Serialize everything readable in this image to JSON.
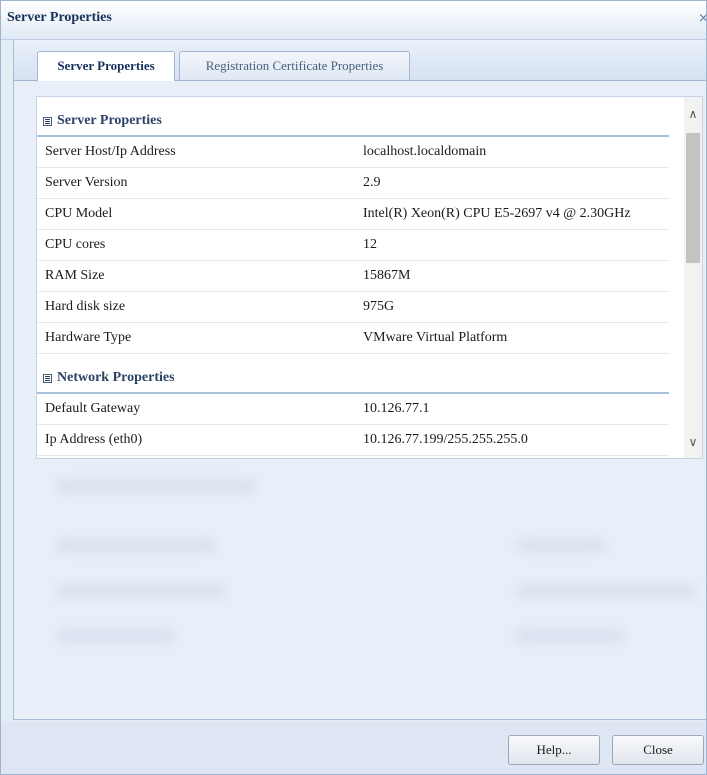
{
  "window": {
    "title": "Server Properties",
    "close_glyph": "×"
  },
  "tabs": [
    {
      "label": "Server Properties",
      "active": true
    },
    {
      "label": "Registration Certificate Properties",
      "active": false
    }
  ],
  "groups": [
    {
      "label": "Server Properties",
      "rows": [
        {
          "key": "Server Host/Ip Address",
          "value": "localhost.localdomain"
        },
        {
          "key": "Server Version",
          "value": "2.9"
        },
        {
          "key": "CPU Model",
          "value": "Intel(R) Xeon(R) CPU E5-2697 v4 @ 2.30GHz"
        },
        {
          "key": "CPU cores",
          "value": "12"
        },
        {
          "key": "RAM Size",
          "value": "15867M"
        },
        {
          "key": "Hard disk size",
          "value": "975G"
        },
        {
          "key": "Hardware Type",
          "value": "VMware Virtual Platform"
        }
      ]
    },
    {
      "label": "Network Properties",
      "rows": [
        {
          "key": "Default Gateway",
          "value": "10.126.77.1"
        },
        {
          "key": "Ip Address (eth0)",
          "value": "10.126.77.199/255.255.255.0"
        }
      ]
    }
  ],
  "scrollbar": {
    "up_glyph": "∧",
    "down_glyph": "∨"
  },
  "buttons": {
    "help": "Help...",
    "close": "Close"
  },
  "colors": {
    "title": "#15305b",
    "group_label": "#2d4467",
    "panel_bg": "#e4ecf6"
  }
}
